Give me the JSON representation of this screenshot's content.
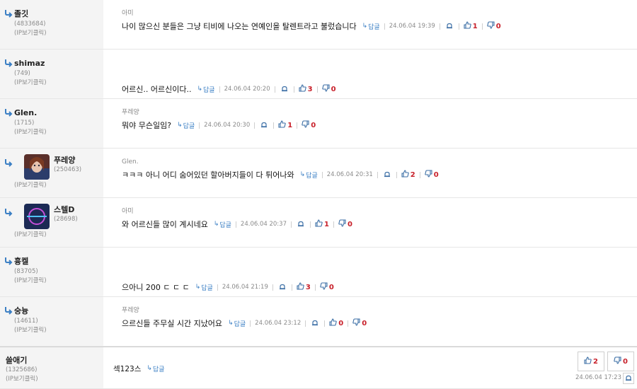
{
  "colors": {
    "accent": "#3b7fc4",
    "vote": "#c8202a",
    "meta": "#8a8a8a",
    "side": "#f4f4f4"
  },
  "reply_label": "답글",
  "comments": [
    {
      "nick": "졸깃",
      "num": "(4833684)",
      "ip": "(IP보기클릭)",
      "reply_to": "아미",
      "text": "나이 많으신 분들은 그냥 티비에 나오는 연예인을 탈렌트라고 불렀습니다",
      "date": "24.06.04 19:39",
      "up": "1",
      "down": "0"
    },
    {
      "nick": "shimaz",
      "num": "(749)",
      "ip": "(IP보기클릭)",
      "reply_to": "",
      "text": "어르신.. 어르신이다..",
      "date": "24.06.04 20:20",
      "up": "3",
      "down": "0"
    },
    {
      "nick": "Glen.",
      "num": "(1715)",
      "ip": "(IP보기클릭)",
      "reply_to": "푸레양",
      "text": "뭐야 무슨일임?",
      "date": "24.06.04 20:30",
      "up": "1",
      "down": "0"
    },
    {
      "nick": "푸레양",
      "num": "(250463)",
      "ip": "(IP보기클릭)",
      "reply_to": "Glen.",
      "avatar": "frozen-character",
      "text": "ㅋㅋㅋ 아니 어디 숨어있던 할아버지들이 다 튀어나와",
      "date": "24.06.04 20:31",
      "up": "2",
      "down": "0"
    },
    {
      "nick": "스텔D",
      "num": "(28698)",
      "ip": "(IP보기클릭)",
      "reply_to": "아미",
      "avatar": "sd-logo",
      "text": "와 어르신들 많이 계시네요",
      "date": "24.06.04 20:37",
      "up": "1",
      "down": "0"
    },
    {
      "nick": "흉켈",
      "num": "(83705)",
      "ip": "(IP보기클릭)",
      "reply_to": "",
      "text": "으아니 200 ㄷ ㄷ ㄷ",
      "date": "24.06.04 21:19",
      "up": "3",
      "down": "0"
    },
    {
      "nick": "숭늉",
      "num": "(14611)",
      "ip": "(IP보기클릭)",
      "reply_to": "푸레양",
      "text": "으르신들 주무실 시간 지났어요",
      "date": "24.06.04 23:12",
      "up": "0",
      "down": "0"
    }
  ],
  "last": {
    "nick": "쓸애기",
    "num": "(1325686)",
    "ip": "(IP보기클릭)",
    "text": "섹123스",
    "date": "24.06.04 17:23",
    "up": "2",
    "down": "0"
  }
}
